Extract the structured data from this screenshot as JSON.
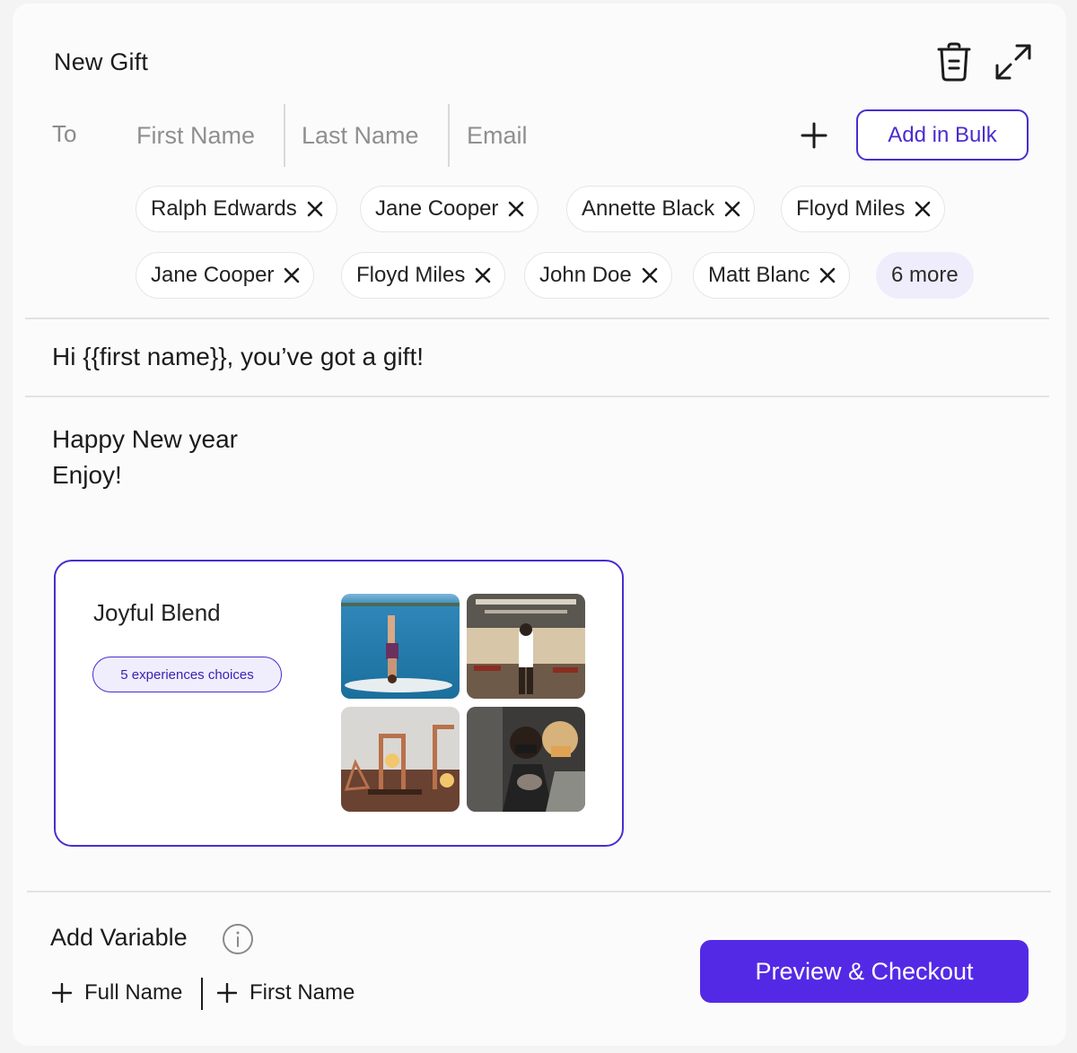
{
  "header": {
    "title": "New Gift",
    "trash_icon": "trash-icon",
    "expand_icon": "expand-icon"
  },
  "recipient": {
    "to_label": "To",
    "first_name_placeholder": "First Name",
    "last_name_placeholder": "Last Name",
    "email_placeholder": "Email",
    "add_icon": "plus-icon",
    "bulk_label": "Add in Bulk"
  },
  "chips": [
    "Ralph Edwards",
    "Jane Cooper",
    "Annette Black",
    "Floyd Miles",
    "Jane Cooper",
    "Floyd Miles",
    "John Doe",
    "Matt Blanc"
  ],
  "more_label": "6 more",
  "subject": "Hi {{first name}}, you’ve got a gift!",
  "message": {
    "line1": "Happy New year",
    "line2": "Enjoy!"
  },
  "gift": {
    "name": "Joyful Blend",
    "choices_label": "5 experiences choices",
    "images": [
      "paddleboard-yoga-photo",
      "restaurant-photo",
      "lamp-making-photo",
      "pottery-workshop-photo"
    ]
  },
  "footer": {
    "add_variable_label": "Add Variable",
    "variables": [
      "Full Name",
      "First Name"
    ],
    "checkout_label": "Preview & Checkout"
  },
  "colors": {
    "accent": "#5429e6",
    "accent_border": "#4b2ccf",
    "chip_more_bg": "#efedfb"
  }
}
